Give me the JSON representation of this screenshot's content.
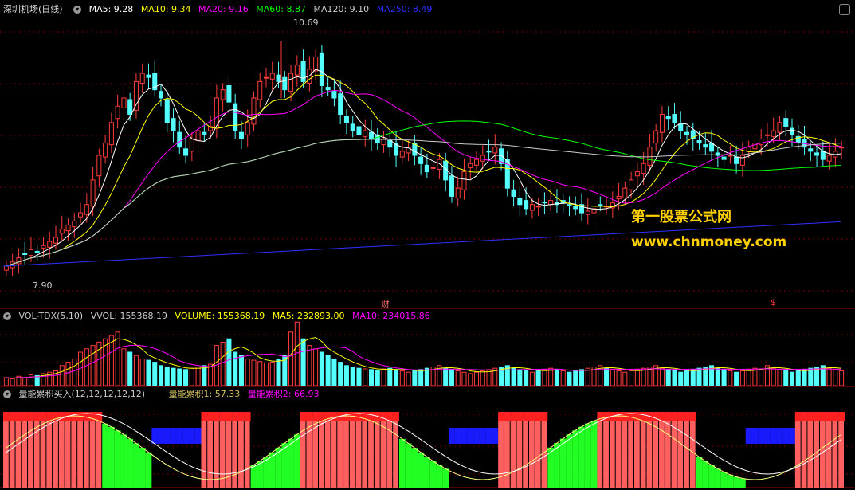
{
  "header": {
    "stock_name": "深圳机场(日线)",
    "ma": [
      {
        "label": "MA5: 9.28",
        "color": "#ffffff"
      },
      {
        "label": "MA10: 9.34",
        "color": "#ffff00"
      },
      {
        "label": "MA20: 9.16",
        "color": "#ff00ff"
      },
      {
        "label": "MA60: 8.87",
        "color": "#00ff00"
      },
      {
        "label": "MA120: 9.10",
        "color": "#cccccc"
      },
      {
        "label": "MA250: 8.49",
        "color": "#3030ff"
      }
    ]
  },
  "annotations": {
    "high": "10.69",
    "low": "7.90",
    "cai": "财",
    "dollar": "$"
  },
  "watermark": {
    "line1": "第一股票公式网",
    "line2": "www.chnmoney.com"
  },
  "vol_panel": {
    "title": "VOL-TDX(5,10)",
    "vvol": "VVOL: 155368.19",
    "volume": "VOLUME: 155368.19",
    "ma5": "MA5: 232893.00",
    "ma10": "MA10: 234015.86"
  },
  "ind_panel": {
    "title": "量能累积买入(12,12,12,12,12)",
    "v1": "量能累积1: 57.33",
    "v2": "量能累积2: 66.93"
  },
  "chart_data": [
    {
      "type": "candlestick",
      "name": "price",
      "ylim": [
        7.6,
        11.0
      ],
      "close": [
        7.95,
        8.0,
        8.05,
        8.1,
        8.15,
        8.12,
        8.2,
        8.25,
        8.3,
        8.4,
        8.45,
        8.5,
        8.6,
        8.7,
        9.0,
        9.3,
        9.45,
        9.7,
        9.9,
        10.0,
        9.8,
        10.2,
        10.3,
        10.25,
        10.1,
        10.0,
        9.7,
        9.6,
        9.4,
        9.3,
        9.5,
        9.6,
        9.55,
        9.65,
        10.0,
        10.1,
        9.95,
        9.6,
        9.5,
        9.7,
        10.0,
        10.2,
        10.25,
        10.3,
        10.2,
        10.1,
        10.3,
        10.4,
        10.2,
        10.35,
        10.5,
        10.15,
        10.1,
        10.0,
        9.8,
        9.7,
        9.6,
        9.55,
        9.6,
        9.5,
        9.45,
        9.5,
        9.4,
        9.3,
        9.35,
        9.4,
        9.3,
        9.2,
        9.1,
        9.15,
        9.25,
        9.0,
        8.8,
        8.9,
        9.1,
        9.2,
        9.25,
        9.3,
        9.35,
        9.4,
        9.2,
        8.9,
        8.8,
        8.7,
        8.65,
        8.7,
        8.68,
        8.72,
        8.75,
        8.7,
        8.72,
        8.7,
        8.65,
        8.6,
        8.62,
        8.65,
        8.7,
        8.68,
        8.72,
        8.8,
        8.9,
        9.0,
        9.1,
        9.2,
        9.4,
        9.6,
        9.8,
        9.75,
        9.7,
        9.6,
        9.55,
        9.5,
        9.45,
        9.4,
        9.35,
        9.3,
        9.25,
        9.3,
        9.2,
        9.3,
        9.4,
        9.45,
        9.5,
        9.55,
        9.6,
        9.7,
        9.65,
        9.55,
        9.45,
        9.4,
        9.35,
        9.3,
        9.25,
        9.3,
        9.35,
        9.4
      ],
      "high": "10.69",
      "low": "7.90"
    },
    {
      "type": "bar",
      "name": "volume",
      "series": [
        {
          "name": "VOLUME",
          "values": [
            12,
            10,
            14,
            12,
            16,
            15,
            18,
            20,
            22,
            30,
            35,
            40,
            50,
            55,
            60,
            65,
            70,
            75,
            80,
            55,
            50,
            45,
            40,
            38,
            35,
            30,
            28,
            26,
            25,
            24,
            26,
            28,
            30,
            32,
            60,
            65,
            70,
            50,
            45,
            40,
            38,
            36,
            34,
            35,
            40,
            45,
            80,
            95,
            70,
            60,
            55,
            50,
            45,
            40,
            35,
            30,
            28,
            26,
            25,
            24,
            22,
            25,
            26,
            24,
            22,
            20,
            22,
            24,
            26,
            28,
            30,
            26,
            24,
            22,
            20,
            18,
            20,
            22,
            24,
            26,
            28,
            30,
            26,
            24,
            22,
            20,
            22,
            24,
            26,
            24,
            22,
            20,
            22,
            24,
            26,
            28,
            30,
            26,
            24,
            22,
            20,
            22,
            24,
            26,
            28,
            30,
            26,
            24,
            22,
            20,
            22,
            24,
            26,
            28,
            30,
            26,
            24,
            22,
            20,
            22,
            24,
            26,
            28,
            30,
            26,
            24,
            22,
            20,
            22,
            24,
            26,
            28,
            30,
            26,
            24,
            22
          ]
        }
      ]
    },
    {
      "type": "area",
      "name": "量能累积买入",
      "series": [
        {
          "name": "量能累积1",
          "values": [
            57.33
          ]
        },
        {
          "name": "量能累积2",
          "values": [
            66.93
          ]
        }
      ]
    }
  ]
}
